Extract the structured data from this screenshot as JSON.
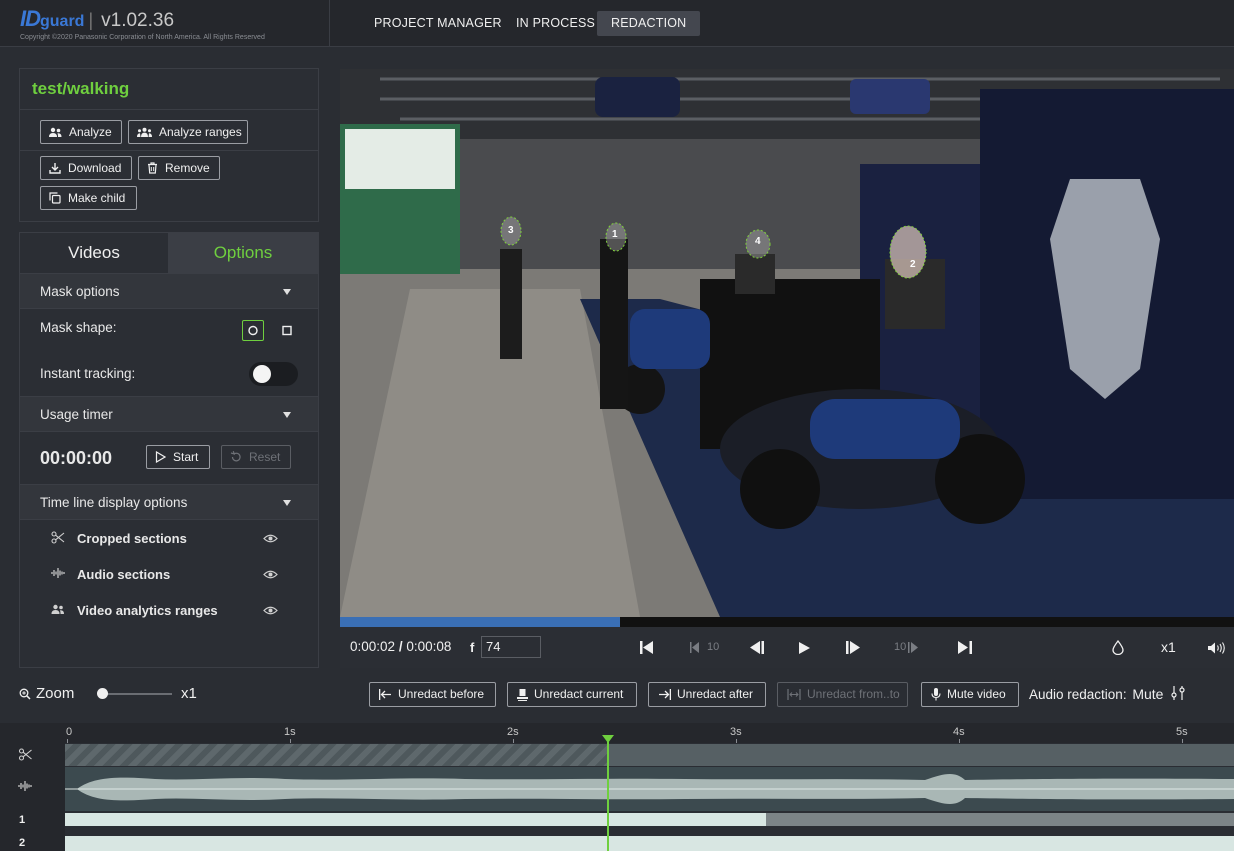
{
  "app": {
    "logo_id": "ID",
    "logo_guard": "guard",
    "version": "v1.02.36",
    "copyright": "Copyright ©2020 Panasonic Corporation of North America. All Rights Reserved",
    "accent_color": "#6fcf3f",
    "brand_color": "#3a78d6"
  },
  "nav": {
    "tabs": [
      {
        "label": "PROJECT MANAGER",
        "active": false
      },
      {
        "label": "IN PROCESS",
        "active": false
      },
      {
        "label": "REDACTION",
        "active": true
      }
    ]
  },
  "project": {
    "title": "test/walking",
    "actions": {
      "analyze": "Analyze",
      "analyze_ranges": "Analyze ranges",
      "download": "Download",
      "remove": "Remove",
      "make_child": "Make child"
    }
  },
  "side_tabs": {
    "videos": "Videos",
    "options": "Options",
    "active": "Options"
  },
  "mask_options": {
    "title": "Mask options",
    "shape_label": "Mask shape:",
    "selected_shape": "circle-icon",
    "instant_tracking_label": "Instant tracking:",
    "instant_tracking_on": false
  },
  "usage_timer": {
    "title": "Usage timer",
    "value": "00:00:00",
    "start_label": "Start",
    "reset_label": "Reset"
  },
  "timeline_display": {
    "title": "Time line display options",
    "items": [
      {
        "label": "Cropped sections",
        "icon": "scissors-icon"
      },
      {
        "label": "Audio sections",
        "icon": "waveform-icon"
      },
      {
        "label": "Video analytics ranges",
        "icon": "people-icon"
      }
    ]
  },
  "player": {
    "current_time": "0:00:02",
    "duration": "0:00:08",
    "time_sep": "/",
    "frame_label": "f",
    "frame_value": "74",
    "progress_fraction": 0.313,
    "skip_back_label": "10",
    "skip_fwd_label": "10",
    "speed": "x1",
    "face_markers": [
      "1",
      "2",
      "3",
      "4"
    ]
  },
  "zoom": {
    "label": "Zoom",
    "value": "x1",
    "level_fraction": 0.0
  },
  "redaction_actions": {
    "unredact_before": "Unredact before",
    "unredact_current": "Unredact current",
    "unredact_after": "Unredact after",
    "unredact_from_to": "Unredact from..to",
    "mute_video": "Mute video",
    "audio_redaction_label": "Audio redaction:",
    "audio_redaction_value": "Mute"
  },
  "timeline": {
    "ticks": [
      "0",
      "1s",
      "2s",
      "3s",
      "4s",
      "5s"
    ],
    "rows": [
      "1",
      "2"
    ],
    "playhead_seconds": 2.43,
    "cropped_until_seconds": 2.43,
    "row1_fill_until_seconds": 3.13
  }
}
